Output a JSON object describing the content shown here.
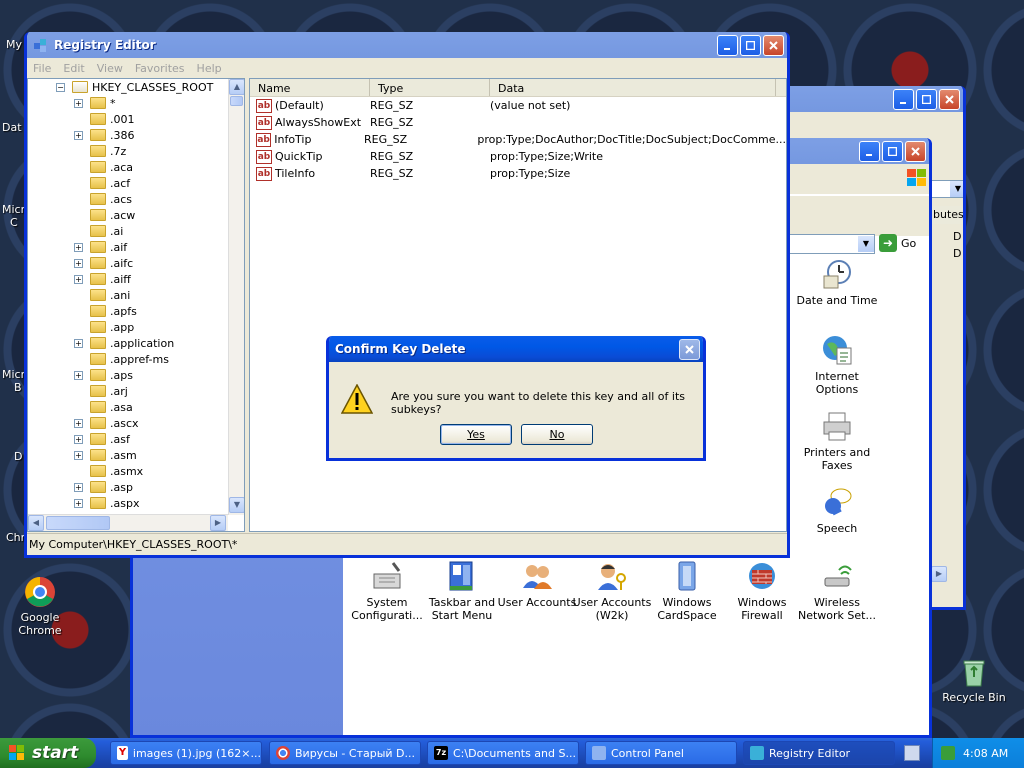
{
  "desktop": {
    "icons": [
      {
        "label": "Google Chrome"
      },
      {
        "label": "Recycle Bin"
      }
    ],
    "partial_labels": [
      "My",
      "Dat",
      "Micro",
      "C",
      "Micro",
      "B",
      "D",
      "Chr"
    ]
  },
  "control_panel": {
    "items": [
      {
        "label": "Date and Time",
        "icon": "clock-icon"
      },
      {
        "label": "Internet Options",
        "icon": "globe-icon"
      },
      {
        "label": "Printers and Faxes",
        "icon": "printer-icon"
      },
      {
        "label": "Speech",
        "icon": "speech-icon"
      },
      {
        "label": "System Configurati...",
        "icon": "system-icon"
      },
      {
        "label": "Taskbar and Start Menu",
        "icon": "taskbar-icon"
      },
      {
        "label": "User Accounts",
        "icon": "users-icon"
      },
      {
        "label": "User Accounts (W2k)",
        "icon": "users-key-icon"
      },
      {
        "label": "Windows CardSpace",
        "icon": "cardspace-icon"
      },
      {
        "label": "Windows Firewall",
        "icon": "firewall-icon"
      },
      {
        "label": "Wireless Network Set...",
        "icon": "wireless-icon"
      }
    ],
    "go_label": "Go",
    "column_fragment": "butes",
    "d_labels": [
      "D",
      "D"
    ]
  },
  "registry": {
    "title": "Registry Editor",
    "menu": [
      "File",
      "Edit",
      "View",
      "Favorites",
      "Help"
    ],
    "tree_root": "HKEY_CLASSES_ROOT",
    "tree": [
      {
        "label": "*",
        "expand": true
      },
      {
        "label": ".001",
        "expand": false
      },
      {
        "label": ".386",
        "expand": true
      },
      {
        "label": ".7z",
        "expand": false
      },
      {
        "label": ".aca",
        "expand": false
      },
      {
        "label": ".acf",
        "expand": false
      },
      {
        "label": ".acs",
        "expand": false
      },
      {
        "label": ".acw",
        "expand": false
      },
      {
        "label": ".ai",
        "expand": false
      },
      {
        "label": ".aif",
        "expand": true
      },
      {
        "label": ".aifc",
        "expand": true
      },
      {
        "label": ".aiff",
        "expand": true
      },
      {
        "label": ".ani",
        "expand": false
      },
      {
        "label": ".apfs",
        "expand": false
      },
      {
        "label": ".app",
        "expand": false
      },
      {
        "label": ".application",
        "expand": true
      },
      {
        "label": ".appref-ms",
        "expand": false
      },
      {
        "label": ".aps",
        "expand": true
      },
      {
        "label": ".arj",
        "expand": false
      },
      {
        "label": ".asa",
        "expand": false
      },
      {
        "label": ".ascx",
        "expand": true
      },
      {
        "label": ".asf",
        "expand": true
      },
      {
        "label": ".asm",
        "expand": true
      },
      {
        "label": ".asmx",
        "expand": false
      },
      {
        "label": ".asp",
        "expand": true
      },
      {
        "label": ".aspx",
        "expand": true
      }
    ],
    "columns": [
      "Name",
      "Type",
      "Data"
    ],
    "values": [
      {
        "name": "(Default)",
        "type": "REG_SZ",
        "data": "(value not set)"
      },
      {
        "name": "AlwaysShowExt",
        "type": "REG_SZ",
        "data": ""
      },
      {
        "name": "InfoTip",
        "type": "REG_SZ",
        "data": "prop:Type;DocAuthor;DocTitle;DocSubject;DocComme..."
      },
      {
        "name": "QuickTip",
        "type": "REG_SZ",
        "data": "prop:Type;Size;Write"
      },
      {
        "name": "TileInfo",
        "type": "REG_SZ",
        "data": "prop:Type;Size"
      }
    ],
    "status": "My Computer\\HKEY_CLASSES_ROOT\\*"
  },
  "dialog": {
    "title": "Confirm Key Delete",
    "message": "Are you sure you want to delete this key and all of its subkeys?",
    "yes": "Yes",
    "no": "No"
  },
  "taskbar": {
    "start": "start",
    "tasks": [
      {
        "label": "images (1).jpg (162×..."
      },
      {
        "label": "Вирусы - Старый D..."
      },
      {
        "label": "C:\\Documents and S..."
      },
      {
        "label": "Control Panel"
      },
      {
        "label": "Registry Editor"
      }
    ],
    "clock": "4:08 AM"
  }
}
